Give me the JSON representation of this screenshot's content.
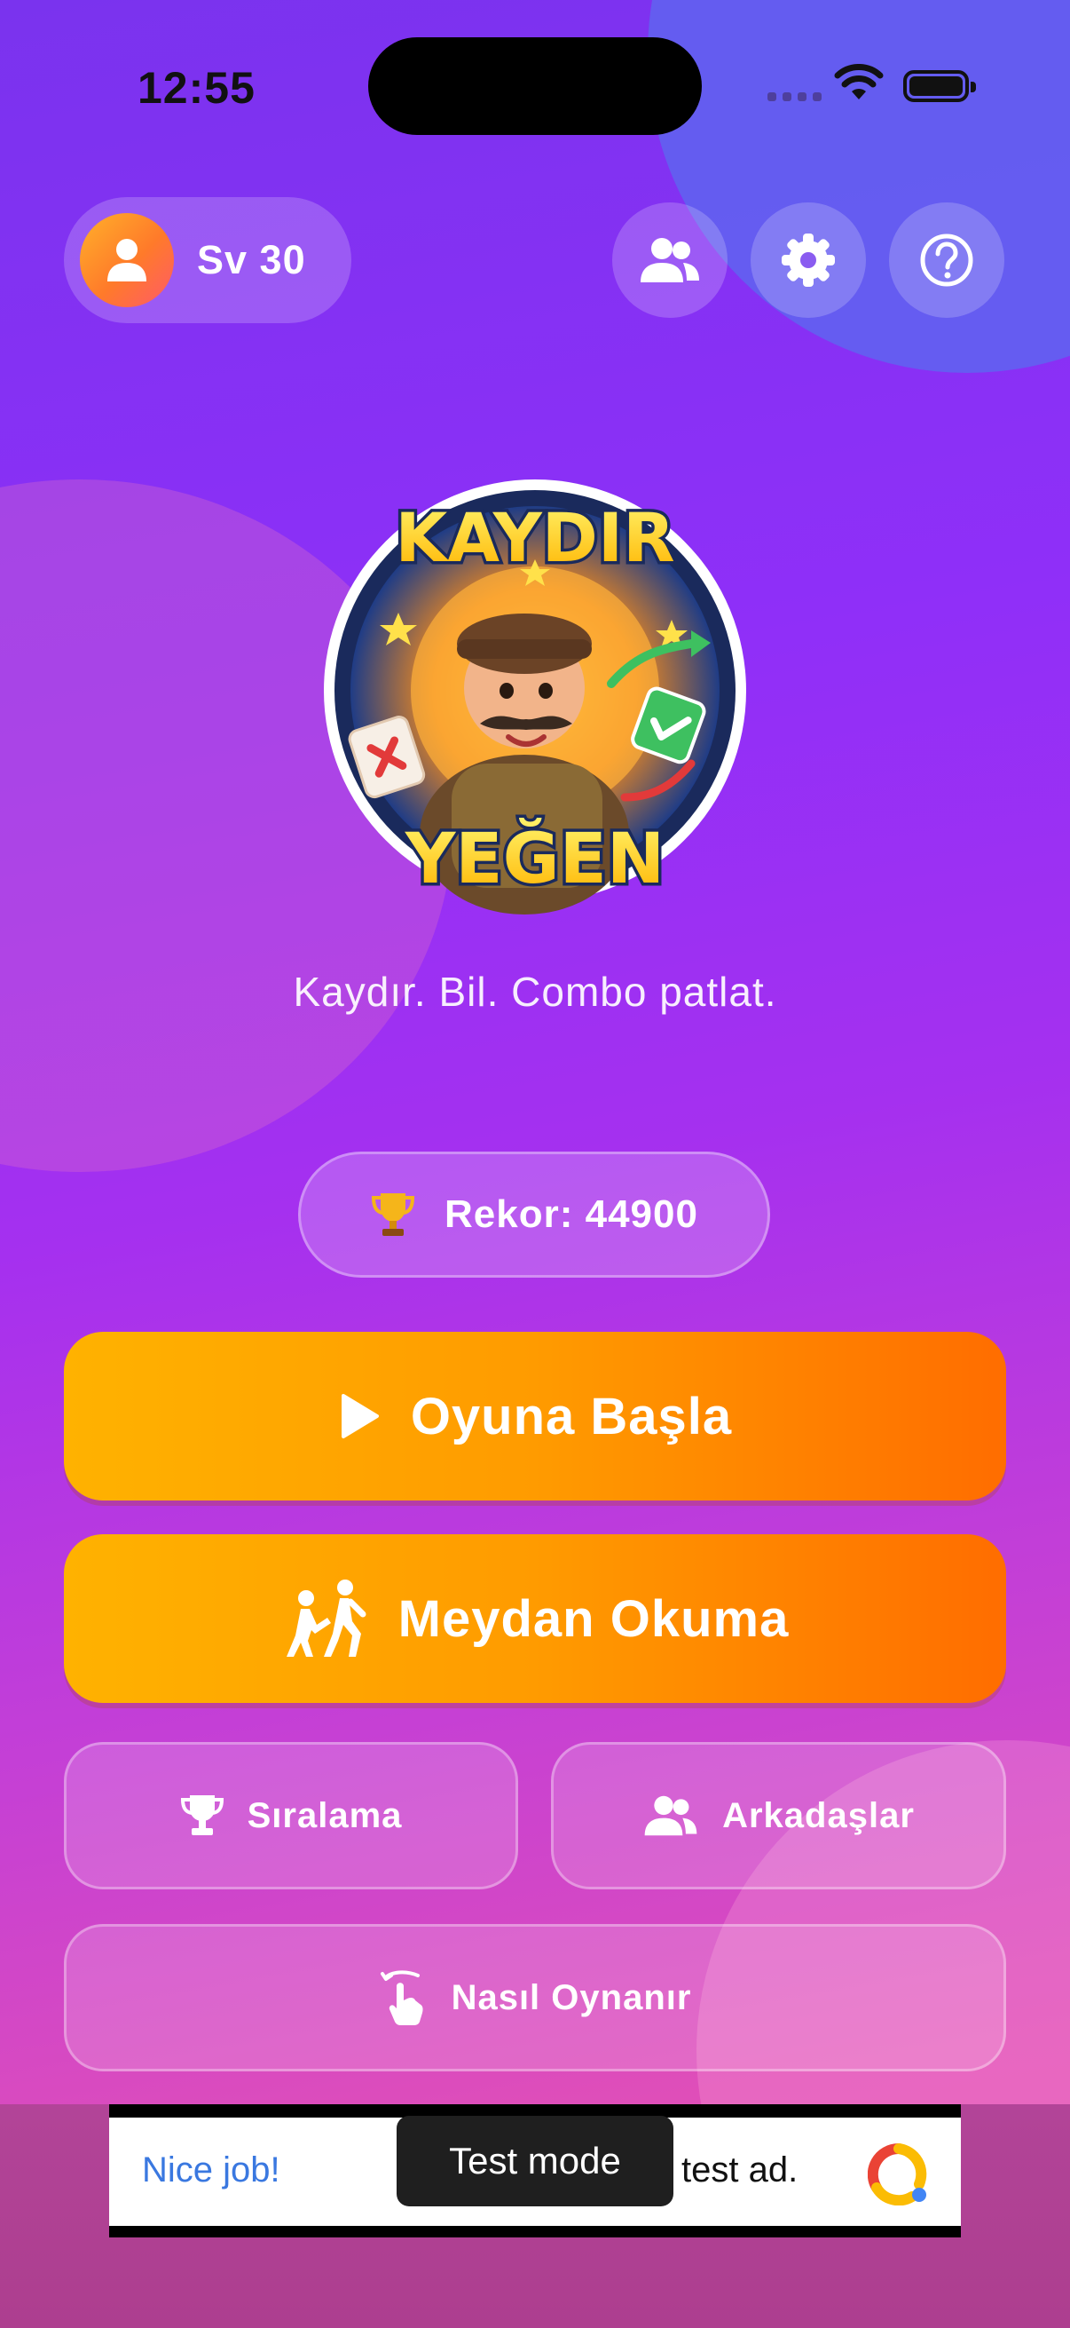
{
  "status_bar": {
    "time": "12:55"
  },
  "top_bar": {
    "level_label": "Sv 30",
    "icons": [
      "user-icon",
      "friends-icon",
      "gear-icon",
      "help-icon"
    ]
  },
  "logo": {
    "line1": "KAYDIR",
    "line2": "YEĞEN"
  },
  "tagline": "Kaydır. Bil. Combo patlat.",
  "record": {
    "label": "Rekor: 44900",
    "icon": "trophy-icon"
  },
  "buttons": {
    "play": "Oyuna Başla",
    "challenge": "Meydan Okuma",
    "leaderboard": "Sıralama",
    "friends": "Arkadaşlar",
    "how_to_play": "Nasıl Oynanır"
  },
  "ad": {
    "left_text": "Nice job!",
    "right_text": "test ad.",
    "toast": "Test mode"
  },
  "colors": {
    "background_top": "#7a33ee",
    "background_bottom": "#e44fae",
    "primary_button_start": "#ffb200",
    "primary_button_end": "#ff6d00",
    "ad_link": "#3a78e0"
  }
}
